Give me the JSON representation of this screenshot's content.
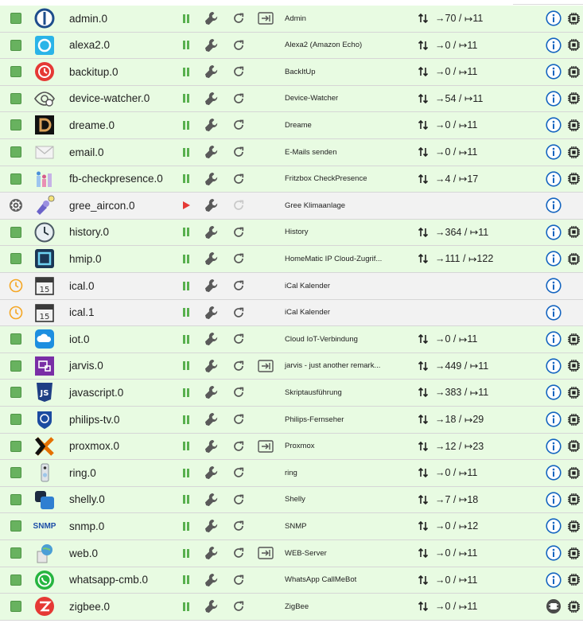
{
  "arrow_in": "→",
  "arrow_out": "↦",
  "colors": {
    "running_row": "#e8fbe2",
    "stopped_row": "#f2f2f2",
    "status_green": "#68b25f",
    "info_blue": "#1565c0",
    "schedule_orange": "#f5a623"
  },
  "instances": [
    {
      "name": "admin.0",
      "title": "Admin",
      "state": "running",
      "logo": "admin-logo",
      "web": true,
      "connected": true,
      "ev_in": "70",
      "ev_out": "11",
      "info_style": "blue",
      "chip": true
    },
    {
      "name": "alexa2.0",
      "title": "Alexa2 (Amazon Echo)",
      "state": "running",
      "logo": "alexa-logo",
      "web": false,
      "connected": true,
      "ev_in": "0",
      "ev_out": "11",
      "info_style": "blue",
      "chip": true
    },
    {
      "name": "backitup.0",
      "title": "BackItUp",
      "state": "running",
      "logo": "backitup-logo",
      "web": false,
      "connected": true,
      "ev_in": "0",
      "ev_out": "11",
      "info_style": "blue",
      "chip": true
    },
    {
      "name": "device-watcher.0",
      "title": "Device-Watcher",
      "state": "running",
      "logo": "device-watcher-logo",
      "web": false,
      "connected": true,
      "ev_in": "54",
      "ev_out": "11",
      "info_style": "blue",
      "chip": true
    },
    {
      "name": "dreame.0",
      "title": "Dreame",
      "state": "running",
      "logo": "dreame-logo",
      "web": false,
      "connected": true,
      "ev_in": "0",
      "ev_out": "11",
      "info_style": "blue",
      "chip": true
    },
    {
      "name": "email.0",
      "title": "E-Mails senden",
      "state": "running",
      "logo": "email-logo",
      "web": false,
      "connected": true,
      "ev_in": "0",
      "ev_out": "11",
      "info_style": "blue",
      "chip": true
    },
    {
      "name": "fb-checkpresence.0",
      "title": "Fritzbox CheckPresence",
      "state": "running",
      "logo": "fb-checkpresence-logo",
      "web": false,
      "connected": true,
      "ev_in": "4",
      "ev_out": "17",
      "info_style": "blue",
      "chip": true
    },
    {
      "name": "gree_aircon.0",
      "title": "Gree Klimaanlage",
      "state": "stopped",
      "logo": "gree-logo",
      "web": false,
      "connected": false,
      "ev_in": "",
      "ev_out": "",
      "info_style": "blue",
      "chip": false
    },
    {
      "name": "history.0",
      "title": "History",
      "state": "running",
      "logo": "history-logo",
      "web": false,
      "connected": true,
      "ev_in": "364",
      "ev_out": "11",
      "info_style": "blue",
      "chip": true
    },
    {
      "name": "hmip.0",
      "title": "HomeMatic IP Cloud-Zugrif...",
      "state": "running",
      "logo": "hmip-logo",
      "web": false,
      "connected": true,
      "ev_in": "111",
      "ev_out": "122",
      "info_style": "blue",
      "chip": true
    },
    {
      "name": "ical.0",
      "title": "iCal Kalender",
      "state": "scheduled",
      "logo": "ical-logo",
      "web": false,
      "connected": false,
      "ev_in": "",
      "ev_out": "",
      "info_style": "blue",
      "chip": false
    },
    {
      "name": "ical.1",
      "title": "iCal Kalender",
      "state": "scheduled",
      "logo": "ical-logo",
      "web": false,
      "connected": false,
      "ev_in": "",
      "ev_out": "",
      "info_style": "blue",
      "chip": false
    },
    {
      "name": "iot.0",
      "title": "Cloud IoT-Verbindung",
      "state": "running",
      "logo": "iot-logo",
      "web": false,
      "connected": true,
      "ev_in": "0",
      "ev_out": "11",
      "info_style": "blue",
      "chip": true
    },
    {
      "name": "jarvis.0",
      "title": "jarvis - just another remark...",
      "state": "running",
      "logo": "jarvis-logo",
      "web": true,
      "connected": true,
      "ev_in": "449",
      "ev_out": "11",
      "info_style": "blue",
      "chip": true
    },
    {
      "name": "javascript.0",
      "title": "Skriptausführung",
      "state": "running",
      "logo": "javascript-logo",
      "web": false,
      "connected": true,
      "ev_in": "383",
      "ev_out": "11",
      "info_style": "blue",
      "chip": true
    },
    {
      "name": "philips-tv.0",
      "title": "Philips-Fernseher",
      "state": "running",
      "logo": "philips-logo",
      "web": false,
      "connected": true,
      "ev_in": "18",
      "ev_out": "29",
      "info_style": "blue",
      "chip": true
    },
    {
      "name": "proxmox.0",
      "title": "Proxmox",
      "state": "running",
      "logo": "proxmox-logo",
      "web": true,
      "connected": true,
      "ev_in": "12",
      "ev_out": "23",
      "info_style": "blue",
      "chip": true
    },
    {
      "name": "ring.0",
      "title": "ring",
      "state": "running",
      "logo": "ring-logo",
      "web": false,
      "connected": true,
      "ev_in": "0",
      "ev_out": "11",
      "info_style": "blue",
      "chip": true
    },
    {
      "name": "shelly.0",
      "title": "Shelly",
      "state": "running",
      "logo": "shelly-logo",
      "web": false,
      "connected": true,
      "ev_in": "7",
      "ev_out": "18",
      "info_style": "blue",
      "chip": true
    },
    {
      "name": "snmp.0",
      "title": "SNMP",
      "state": "running",
      "logo": "snmp-logo",
      "logo_text": "SNMP",
      "web": false,
      "connected": true,
      "ev_in": "0",
      "ev_out": "12",
      "info_style": "blue",
      "chip": true
    },
    {
      "name": "web.0",
      "title": "WEB-Server",
      "state": "running",
      "logo": "web-logo",
      "web": true,
      "connected": true,
      "ev_in": "0",
      "ev_out": "11",
      "info_style": "blue",
      "chip": true
    },
    {
      "name": "whatsapp-cmb.0",
      "title": "WhatsApp CallMeBot",
      "state": "running",
      "logo": "whatsapp-logo",
      "web": false,
      "connected": true,
      "ev_in": "0",
      "ev_out": "11",
      "info_style": "blue",
      "chip": true
    },
    {
      "name": "zigbee.0",
      "title": "ZigBee",
      "state": "running",
      "logo": "zigbee-logo",
      "web": false,
      "connected": true,
      "ev_in": "0",
      "ev_out": "11",
      "info_style": "dark",
      "chip": true
    }
  ]
}
